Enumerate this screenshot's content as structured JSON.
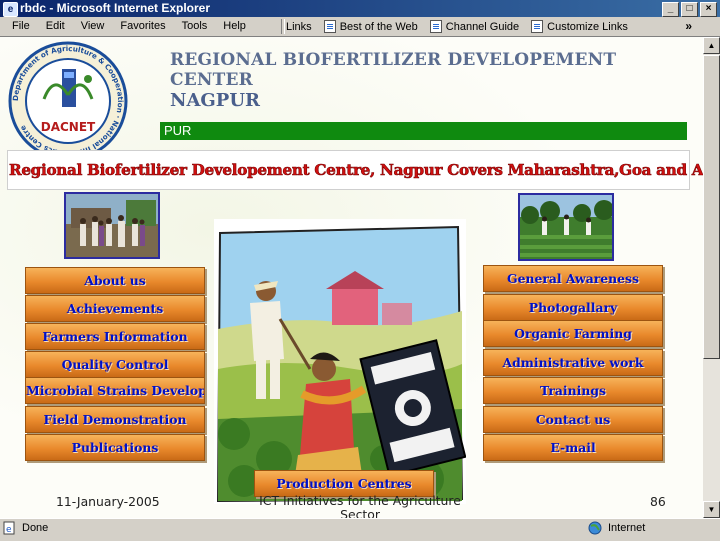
{
  "window": {
    "title": "rbdc - Microsoft Internet Explorer"
  },
  "menu": [
    "File",
    "Edit",
    "View",
    "Favorites",
    "Tools",
    "Help"
  ],
  "links_bar": {
    "label": "Links",
    "items": [
      "Best of the Web",
      "Channel Guide",
      "Customize Links"
    ],
    "overflow": "»"
  },
  "header": {
    "title": "REGIONAL BIOFERTILIZER DEVELOPEMENT CENTER",
    "city": "NAGPUR",
    "marquee": "PUR",
    "banner": "Regional Biofertilizer Developement Centre, Nagpur Covers Maharashtra,Goa and Andhra Pradesh",
    "logo_text": "DACNET",
    "logo_ring_text": "Department of Agriculture & Cooperation · National Informatics Centre"
  },
  "left_nav": [
    "About us",
    "Achievements",
    "Farmers Information",
    "Quality Control",
    "Microbial Strains Developed",
    "Field Demonstration",
    "Publications"
  ],
  "right_nav": [
    "General Awareness",
    "Photogallary",
    "Organic Farming",
    "Administrative work",
    "Trainings",
    "Contact us",
    "E-mail"
  ],
  "bottom_nav": "Production Centres",
  "slide_footer": {
    "date": "11-January-2005",
    "title": "ICT Initiatives for the Agriculture Sector",
    "page": "86"
  },
  "status": {
    "left": "Done",
    "right": "Internet"
  },
  "colors": {
    "title_bar": "#0a246a",
    "marquee": "#0f8a0f",
    "banner_text": "#d01010",
    "button": "#e9892c",
    "button_text": "#0010c8"
  }
}
